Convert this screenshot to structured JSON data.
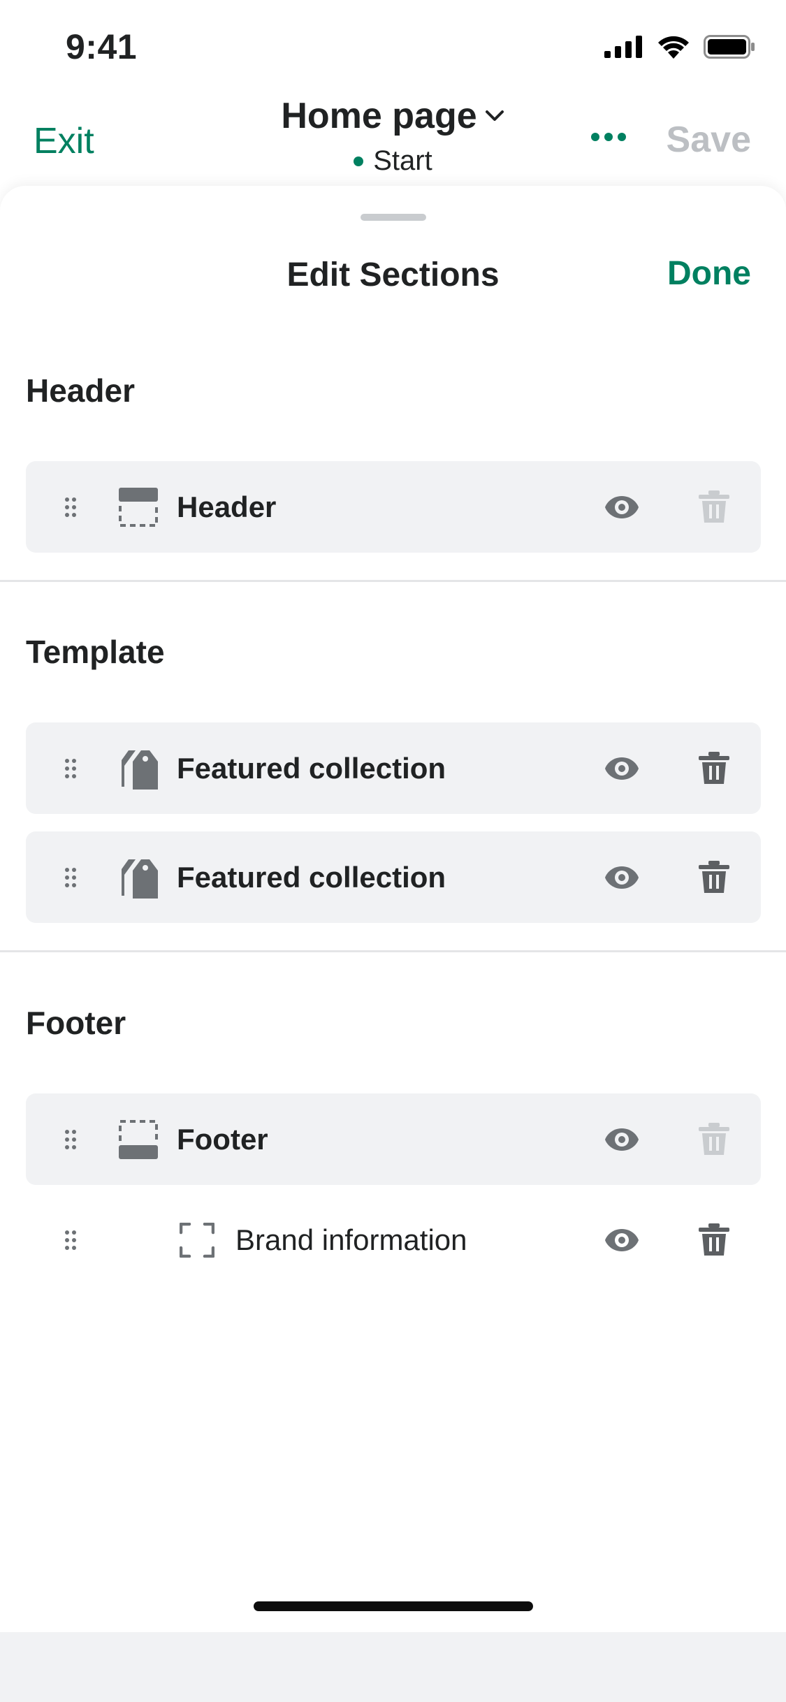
{
  "status_bar": {
    "time": "9:41"
  },
  "nav": {
    "exit_label": "Exit",
    "title": "Home page",
    "status_text": "Start",
    "save_label": "Save",
    "accent": "#008060"
  },
  "sheet": {
    "title": "Edit Sections",
    "done_label": "Done"
  },
  "groups": [
    {
      "label": "Header",
      "items": [
        {
          "label": "Header",
          "icon": "header-layout-icon",
          "visible": true,
          "deletable": false
        }
      ]
    },
    {
      "label": "Template",
      "items": [
        {
          "label": "Featured collection",
          "icon": "tag-icon",
          "visible": true,
          "deletable": true
        },
        {
          "label": "Featured collection",
          "icon": "tag-icon",
          "visible": true,
          "deletable": true
        }
      ]
    },
    {
      "label": "Footer",
      "items": [
        {
          "label": "Footer",
          "icon": "footer-layout-icon",
          "visible": true,
          "deletable": false
        },
        {
          "label": "Brand information",
          "icon": "block-icon",
          "visible": true,
          "deletable": true,
          "nested": true
        }
      ]
    }
  ]
}
